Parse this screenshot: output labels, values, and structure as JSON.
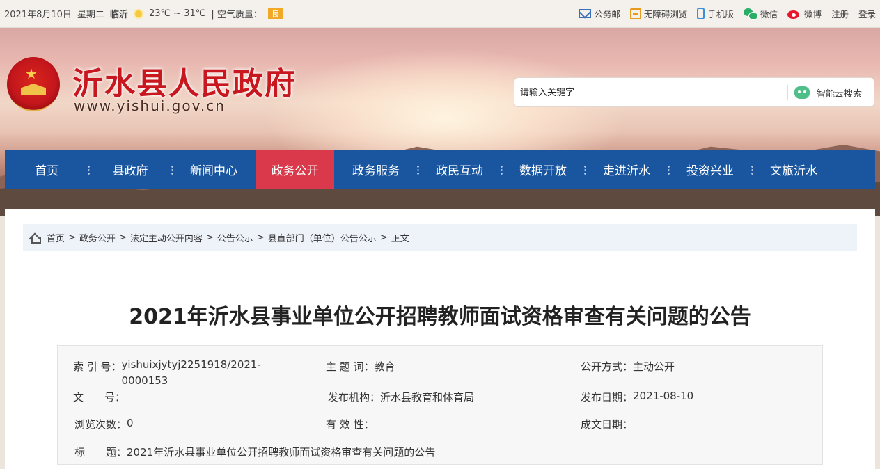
{
  "topbar": {
    "date": "2021年8月10日",
    "weekday": "星期二",
    "city": "临沂",
    "temp": "23℃ ~ 31℃",
    "air_label": "| 空气质量：",
    "air_quality": "良",
    "links": {
      "mail": "公务邮",
      "accessible": "无障碍浏览",
      "mobile": "手机版",
      "wechat": "微信",
      "weibo": "微博",
      "register": "注册",
      "login": "登录"
    }
  },
  "header": {
    "site_title": "沂水县人民政府",
    "site_url": "www.yishui.gov.cn",
    "search_placeholder": "请输入关键字",
    "search_button": "智能云搜索"
  },
  "nav": [
    "首页",
    "县政府",
    "新闻中心",
    "政务公开",
    "政务服务",
    "政民互动",
    "数据开放",
    "走进沂水",
    "投资兴业",
    "文旅沂水"
  ],
  "nav_active": "政务公开",
  "breadcrumb": [
    "首页",
    "政务公开",
    "法定主动公开内容",
    "公告公示",
    "县直部门（单位）公告公示",
    "正文"
  ],
  "article": {
    "title": "2021年沂水县事业单位公开招聘教师面试资格审查有关问题的公告",
    "meta": {
      "index_label": "索 引 号：",
      "index_value": "yishuixjytyj2251918/2021-0000153",
      "subject_label": "主 题 词：",
      "subject_value": "教育",
      "method_label": "公开方式：",
      "method_value": "主动公开",
      "doc_label": "文　　号：",
      "doc_value": "",
      "org_label": "发布机构：",
      "org_value": "沂水县教育和体育局",
      "date_label": "发布日期：",
      "date_value": "2021-08-10",
      "views_label": "浏览次数：",
      "views_value": "0",
      "valid_label": "有 效 性：",
      "valid_value": "",
      "made_label": "成文日期：",
      "made_value": "",
      "title_label": "标　　题：",
      "title_value": "2021年沂水县事业单位公开招聘教师面试资格审查有关问题的公告"
    }
  },
  "colors": {
    "nav_bg": "#1a56a0",
    "nav_active": "#d9394a",
    "site_title": "#c8171e",
    "aqi_badge": "#f0a826"
  }
}
